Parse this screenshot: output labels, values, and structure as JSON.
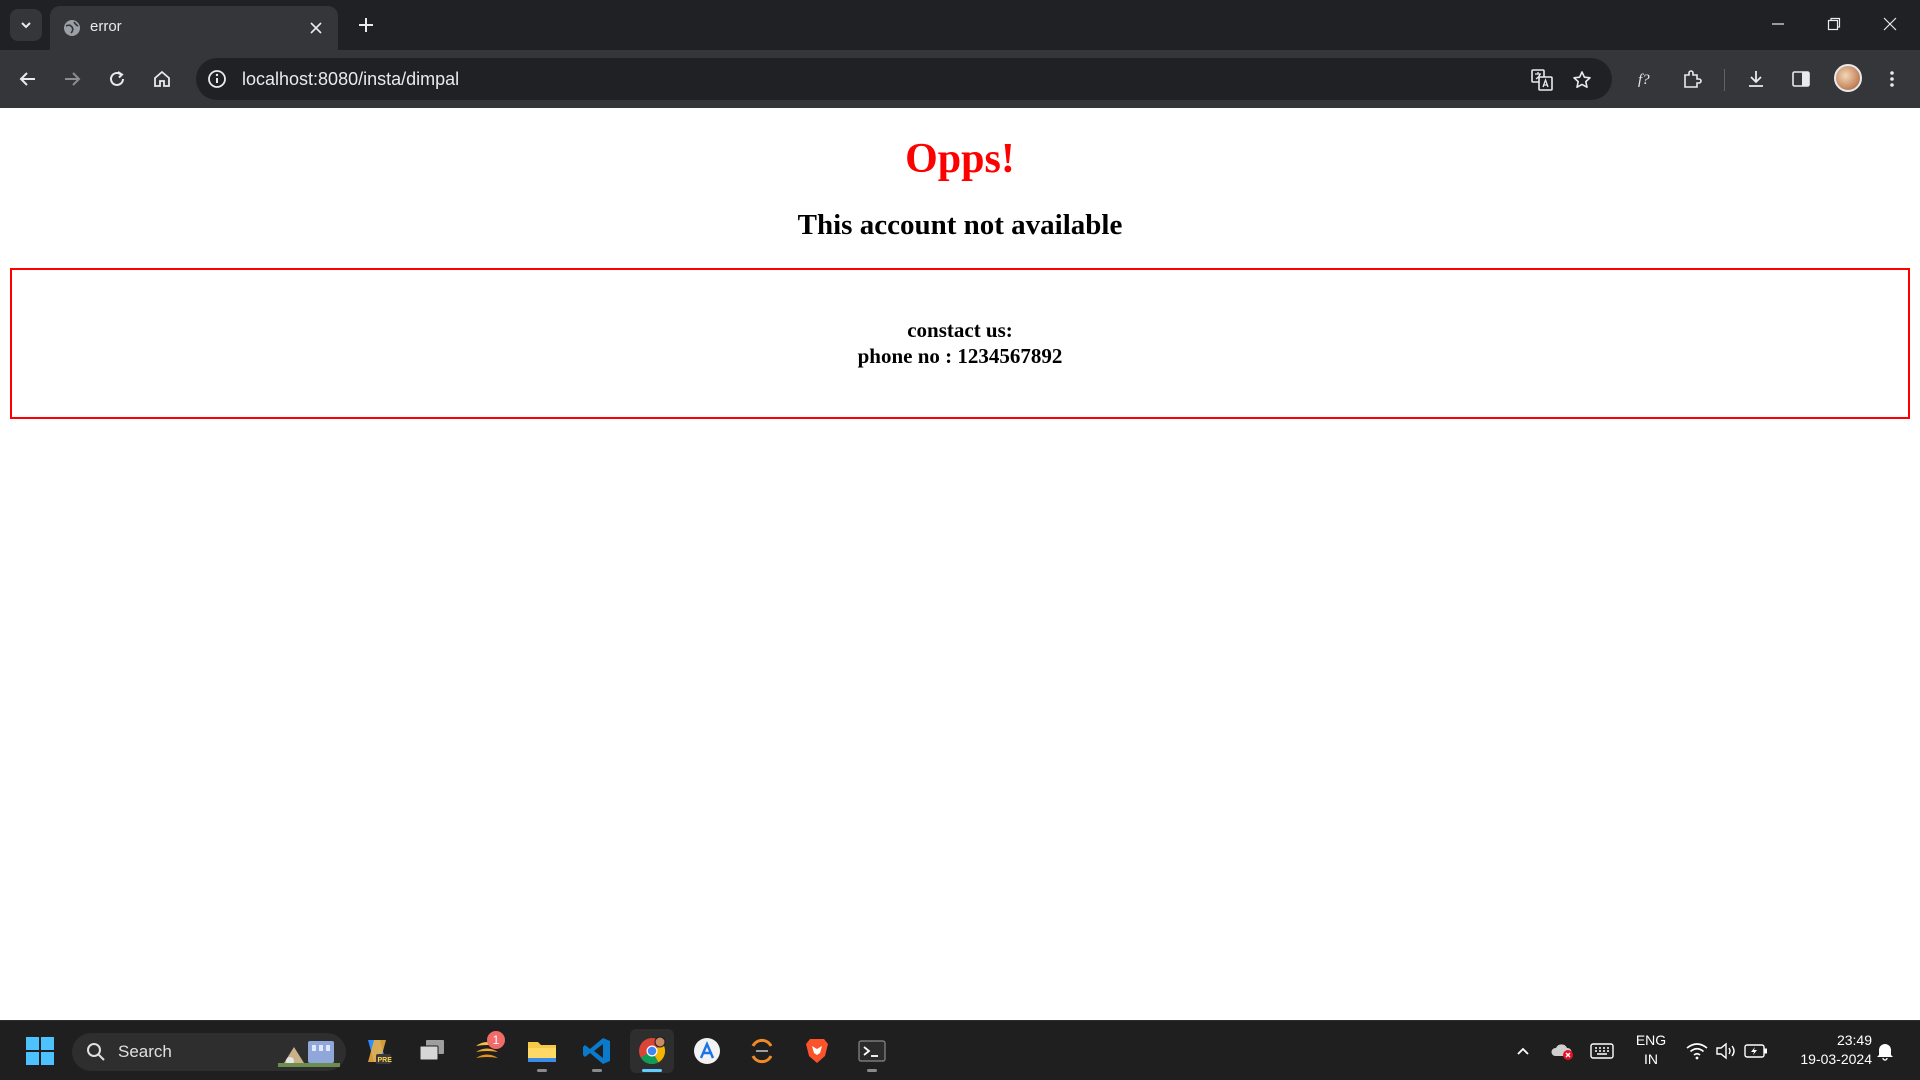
{
  "browser": {
    "tab_title": "error",
    "address_url": "localhost:8080/insta/dimpal"
  },
  "page": {
    "heading": "Opps!",
    "subheading": "This account not available",
    "contact_label": "constact us:",
    "phone_line": "phone no : 1234567892",
    "colors": {
      "accent_red": "#ff0000",
      "text": "#000000"
    }
  },
  "taskbar": {
    "search_placeholder": "Search",
    "notification_badge": "1",
    "language_primary": "ENG",
    "language_region": "IN",
    "time": "23:49",
    "date": "19-03-2024"
  }
}
